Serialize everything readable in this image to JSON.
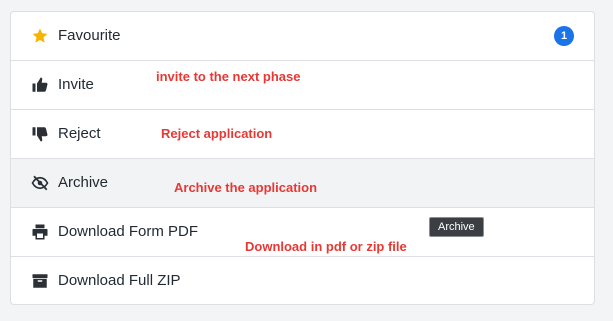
{
  "menu": {
    "items": [
      {
        "label": "Favourite",
        "icon": "star-icon"
      },
      {
        "label": "Invite",
        "icon": "thumbs-up-icon"
      },
      {
        "label": "Reject",
        "icon": "thumbs-down-icon"
      },
      {
        "label": "Archive",
        "icon": "eye-slash-icon"
      },
      {
        "label": "Download Form PDF",
        "icon": "printer-icon"
      },
      {
        "label": "Download Full ZIP",
        "icon": "archive-box-icon"
      }
    ],
    "favourite_badge": "1"
  },
  "annotations": {
    "invite": "invite to the next phase",
    "reject": "Reject application",
    "archive": "Archive the application",
    "download": "Download in pdf or zip file"
  },
  "tooltip": {
    "text": "Archive"
  },
  "colors": {
    "star": "#f5b400",
    "badge": "#1a73e8",
    "annotation": "#e53935",
    "icon": "#2b2f36"
  }
}
